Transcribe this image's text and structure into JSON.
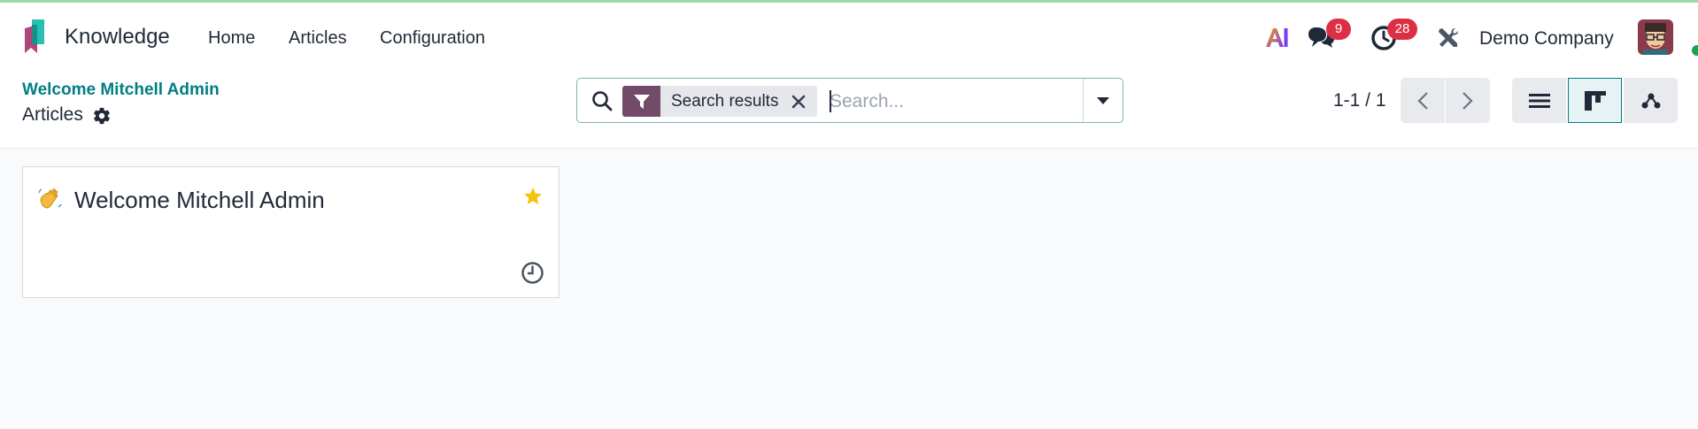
{
  "app": {
    "name": "Knowledge"
  },
  "nav": {
    "home": "Home",
    "articles": "Articles",
    "configuration": "Configuration"
  },
  "systray": {
    "ai_label": "AI",
    "chat_count": "9",
    "activity_count": "28",
    "company": "Demo Company"
  },
  "breadcrumb": {
    "parent": "Welcome Mitchell Admin",
    "current": "Articles"
  },
  "search": {
    "facet_label": "Search results",
    "placeholder": "Search..."
  },
  "pager": {
    "value": "1-1 / 1"
  },
  "card": {
    "emoji": "👋",
    "title": "Welcome Mitchell Admin",
    "favorite": true
  },
  "colors": {
    "brand": "#714b67",
    "accent": "#017e84",
    "badge": "#dc2f45",
    "star": "#f3c30d"
  }
}
